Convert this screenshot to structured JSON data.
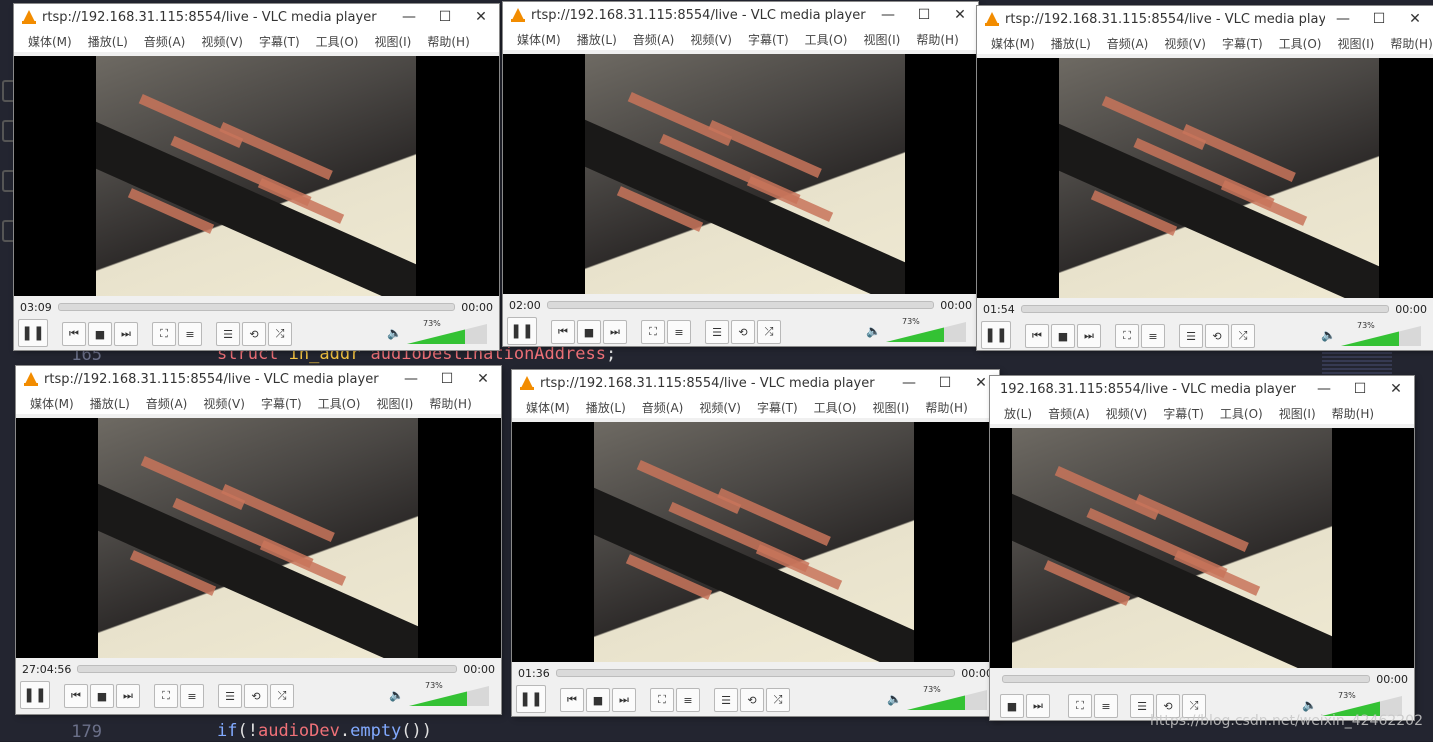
{
  "editor": {
    "line_numbers": [
      "165",
      "179"
    ],
    "line165": {
      "kw": "struct ",
      "ty": "in_addr ",
      "var": "audioDestinationAddress",
      "end": ";"
    },
    "line179": {
      "kw": "if",
      "p1": "(!",
      "var": "audioDev",
      "p2": ".",
      "fn": "empty",
      "end": "())"
    }
  },
  "watermark": "https://blog.csdn.net/weixin_42462202",
  "vlc_common": {
    "title": "rtsp://192.168.31.115:8554/live - VLC media player",
    "title_clipped": "192.168.31.115:8554/live - VLC media player",
    "minimize": "—",
    "maximize": "☐",
    "close": "✕",
    "menus": [
      "媒体(M)",
      "播放(L)",
      "音频(A)",
      "视频(V)",
      "字幕(T)",
      "工具(O)",
      "视图(I)",
      "帮助(H)"
    ],
    "menus_clipped": [
      "放(L)",
      "音频(A)",
      "视频(V)",
      "字幕(T)",
      "工具(O)",
      "视图(I)",
      "帮助(H)"
    ],
    "end_time": "00:00",
    "volume": "73%",
    "volume_level": 0.73
  },
  "windows": [
    {
      "id": "w1",
      "elapsed": "03:09"
    },
    {
      "id": "w2",
      "elapsed": "02:00"
    },
    {
      "id": "w3",
      "elapsed": "01:54"
    },
    {
      "id": "w4",
      "elapsed": "27:04:56"
    },
    {
      "id": "w5",
      "elapsed": "01:36"
    },
    {
      "id": "w6",
      "elapsed": ""
    }
  ],
  "icons": {
    "pause": "❚❚",
    "prev": "⏮",
    "stop": "■",
    "next": "⏭",
    "fullscreen": "⛶",
    "eq": "≡",
    "playlist": "☰",
    "loop": "⟲",
    "shuffle": "⤮",
    "speaker": "🔈"
  }
}
